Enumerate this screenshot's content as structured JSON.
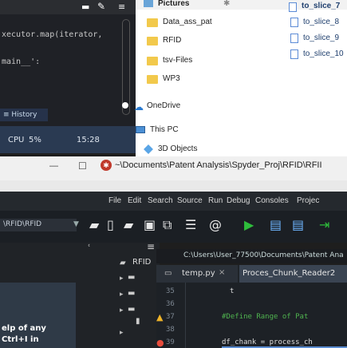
{
  "editor": {
    "code_line1": "xecutor.map(iterator,",
    "code_line2": "main__':",
    "history_label": "History",
    "cpu_label": "CPU",
    "cpu_value": "5%",
    "clock": "15:28"
  },
  "explorer": {
    "pictures_label": "Pictures",
    "items": [
      "Data_ass_pat",
      "RFID",
      "tsv-Files",
      "WP3"
    ],
    "onedrive": "OneDrive",
    "thispc": "This PC",
    "objects3d": "3D Objects",
    "right_files": [
      "to_slice_7",
      "to_slice_8",
      "to_slice_9",
      "to_slice_10"
    ]
  },
  "titlebar": {
    "title": "~\\Documents\\Patent Analysis\\Spyder_Proj\\RFID\\RFII",
    "minimize": "—",
    "maximize": "☐"
  },
  "menu": {
    "items": [
      "File",
      "Edit",
      "Search",
      "Source",
      "Run",
      "Debug",
      "Consoles",
      "Projec"
    ]
  },
  "toolbar": {
    "path_field": "\\RFID\\RFID"
  },
  "leftpanel": {
    "folder": "RFID",
    "help_line1": "elp of any",
    "help_line2": "Ctrl+I in"
  },
  "pane": {
    "path": "C:\\Users\\User_77500\\Documents\\Patent Ana",
    "tab1": "temp.py",
    "tab2": "Proces_Chunk_Reader2",
    "line_numbers": [
      "35",
      "36",
      "37",
      "38",
      "39"
    ],
    "code": [
      "t",
      "",
      "#Define Range of Pat",
      "",
      "df_chank = process_ch"
    ]
  },
  "colors": {
    "accent": "#3d7fc6",
    "run_green": "#2ebd3b",
    "comment_green": "#4fb34f",
    "warning": "#f0b429"
  }
}
